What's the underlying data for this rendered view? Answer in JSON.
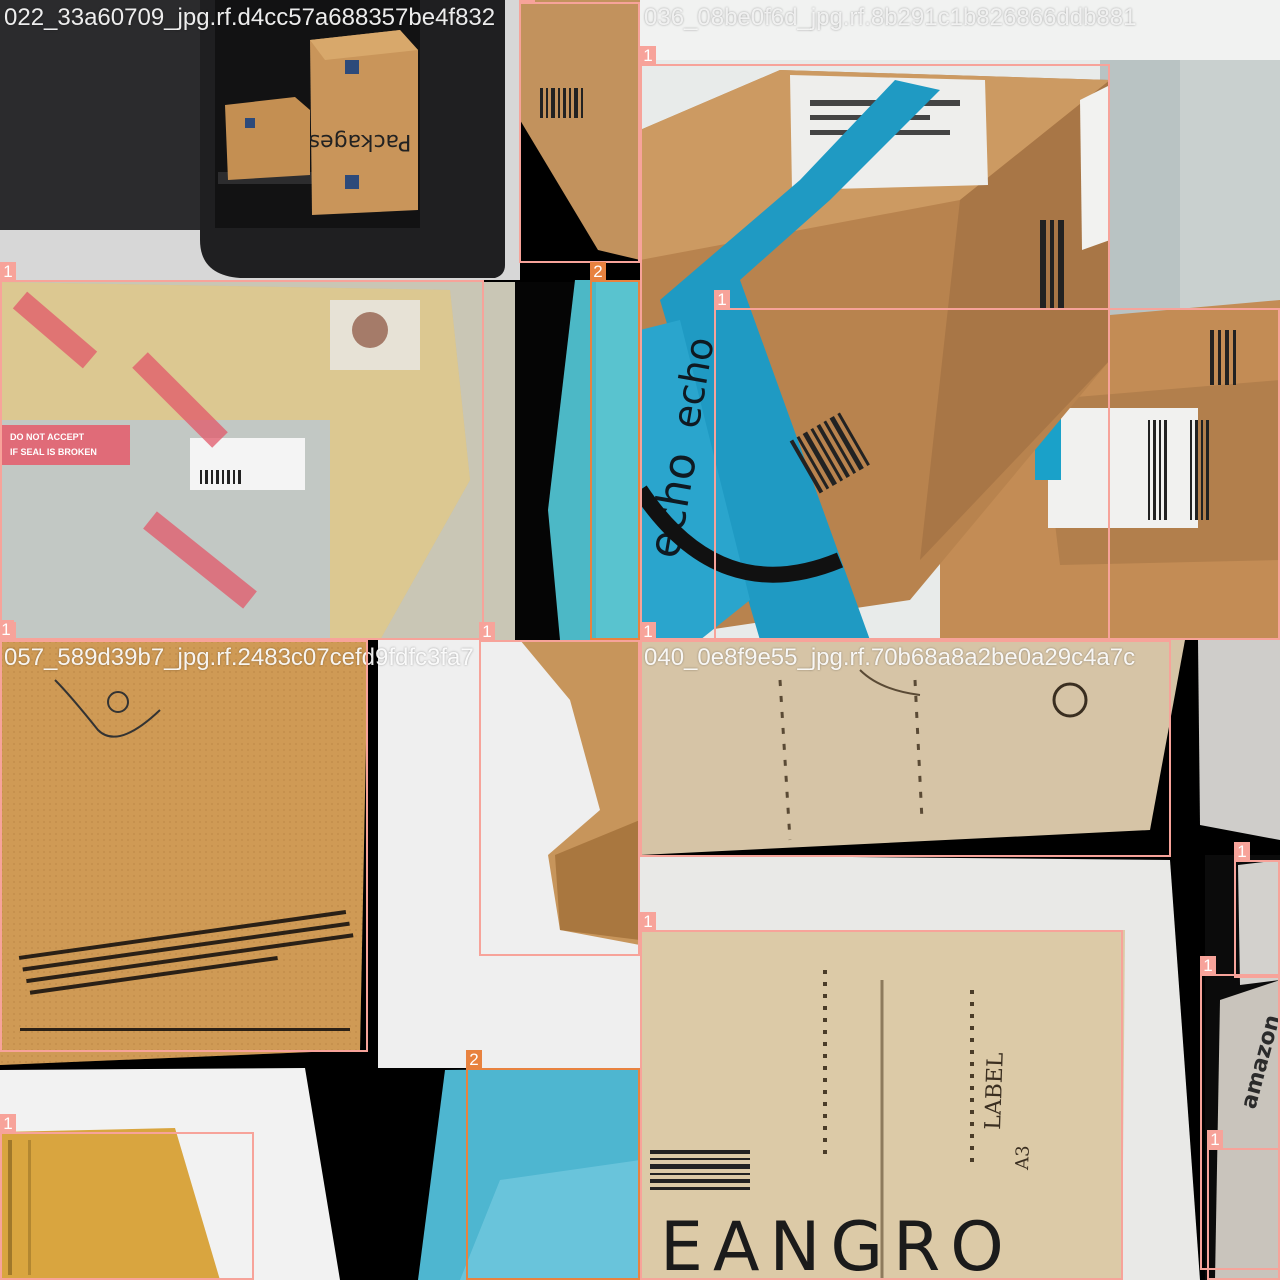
{
  "tiles": [
    {
      "title": "022_33a60709_jpg.rf.d4cc57a688357be4f832"
    },
    {
      "title": "036_08be0f6d_jpg.rf.8b291c1b826866ddb881"
    },
    {
      "title": "057_589d39b7_jpg.rf.2483c07cefd9fdfc3fa7"
    },
    {
      "title": "040_0e8f9e55_jpg.rf.70b68a8a2be0a29c4a7c"
    }
  ],
  "box_labels": [
    "1",
    "1",
    "2",
    "1",
    "1",
    "1",
    "1",
    "1",
    "1",
    "2",
    "1",
    "1",
    "1",
    "1",
    "1"
  ],
  "visible_text": {
    "packages": "Packages",
    "echo": "echo",
    "label_word": "LABEL",
    "label_size": "A3",
    "brand_fragment": "EANGRO",
    "amazon_fragment": "amazon",
    "do_not_accept": "DO NOT ACCEPT",
    "seal_broken": "IF SEAL IS BROKEN"
  },
  "colors": {
    "class1": "#f7a39a",
    "class2": "#e8823f",
    "cardboard": "#c69a64",
    "tape_blue": "#1f9ac3",
    "envelope": "#d8a83e"
  }
}
